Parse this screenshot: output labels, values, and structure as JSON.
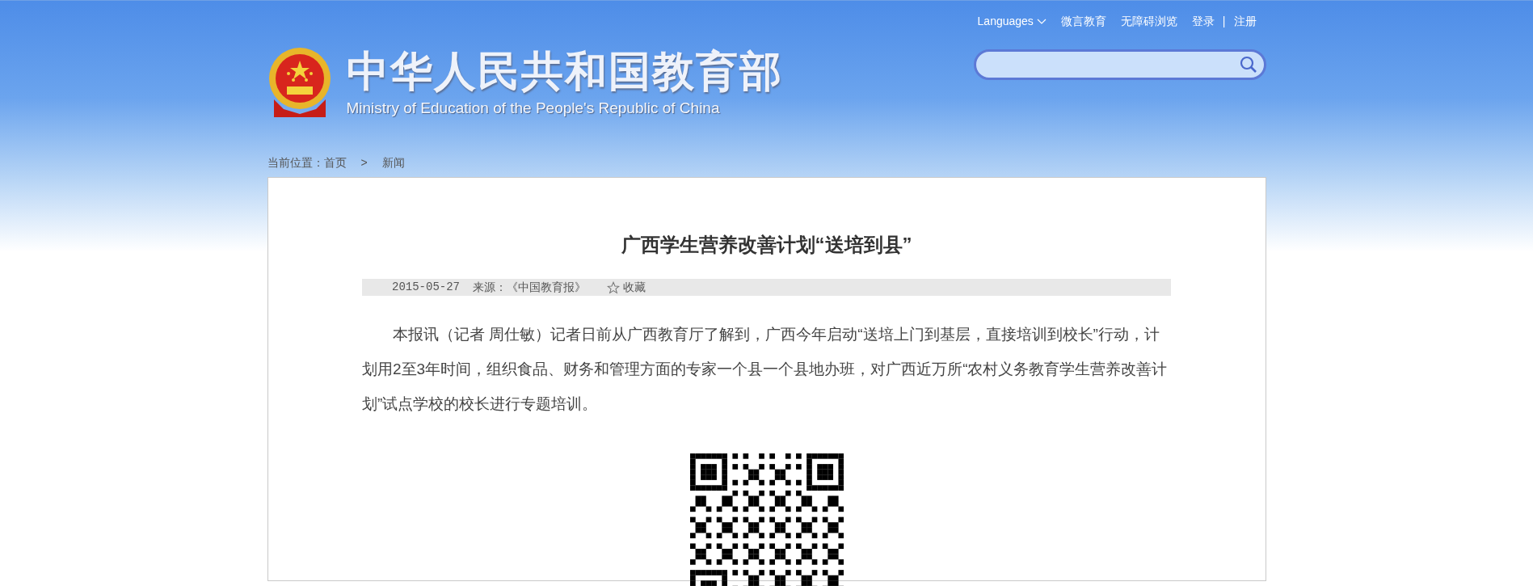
{
  "top_links": {
    "languages": "Languages",
    "items": [
      "微言教育",
      "无障碍浏览"
    ],
    "login": "登录",
    "separator": "|",
    "register": "注册"
  },
  "logo": {
    "title": "中华人民共和国教育部",
    "subtitle": "Ministry of Education of the People's Republic of China"
  },
  "breadcrumb": {
    "label": "当前位置：",
    "items": [
      "首页",
      "新闻"
    ],
    "separator": ">"
  },
  "article": {
    "title": "广西学生营养改善计划“送培到县”",
    "date": "2015-05-27",
    "source": "来源：《中国教育报》",
    "favorite": "收藏",
    "paragraphs": [
      "本报讯（记者 周仕敏）记者日前从广西教育厅了解到，广西今年启动“送培上门到基层，直接培训到校长”行动，计划用2至3年时间，组织食品、财务和管理方面的专家一个县一个县地办班，对广西近万所“农村义务教育学生营养改善计划”试点学校的校长进行专题培训。"
    ]
  }
}
